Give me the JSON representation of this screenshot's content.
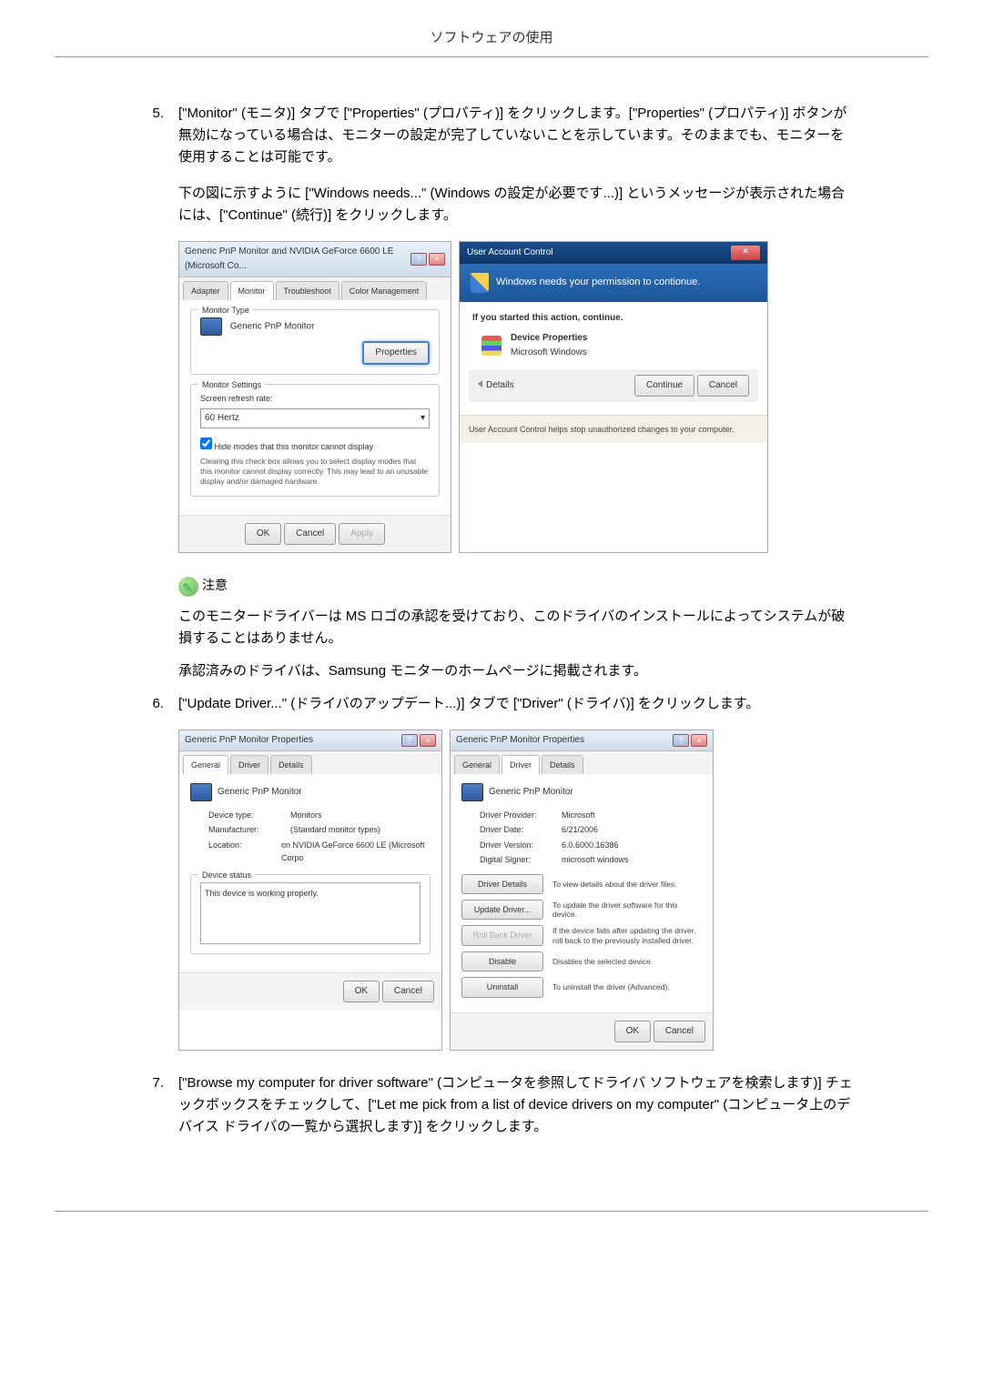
{
  "header": "ソフトウェアの使用",
  "step5": {
    "num": "5.",
    "text": "[\"Monitor\" (モニタ)] タブで [\"Properties\" (プロパティ)] をクリックします。[\"Properties\" (プロパティ)] ボタンが無効になっている場合は、モニターの設定が完了していないことを示しています。そのままでも、モニターを使用することは可能です。",
    "text2": "下の図に示すように [\"Windows needs...\" (Windows の設定が必要です...)] というメッセージが表示された場合には、[\"Continue\" (続行)] をクリックします。"
  },
  "dialog1": {
    "title": "Generic PnP Monitor and NVIDIA GeForce 6600 LE (Microsoft Co...",
    "tabs": {
      "adapter": "Adapter",
      "monitor": "Monitor",
      "troubleshoot": "Troubleshoot",
      "color": "Color Management"
    },
    "monitor_type_label": "Monitor Type",
    "monitor_name": "Generic PnP Monitor",
    "properties_btn": "Properties",
    "monitor_settings_label": "Monitor Settings",
    "refresh_label": "Screen refresh rate:",
    "refresh_value": "60 Hertz",
    "hide_modes_check": "Hide modes that this monitor cannot display",
    "hide_modes_desc": "Clearing this check box allows you to select display modes that this monitor cannot display correctly. This may lead to an unusable display and/or damaged hardware.",
    "ok": "OK",
    "cancel": "Cancel",
    "apply": "Apply"
  },
  "uac": {
    "title": "User Account Control",
    "banner": "Windows needs your permission to contionue.",
    "started": "If you started this action, continue.",
    "prog_name": "Device Properties",
    "prog_vendor": "Microsoft Windows",
    "details": "Details",
    "continue": "Continue",
    "cancel": "Cancel",
    "footer": "User Account Control helps stop unauthorized changes to your computer."
  },
  "note": {
    "label": "注意",
    "text1": "このモニタードライバーは MS ロゴの承認を受けており、このドライバのインストールによってシステムが破損することはありません。",
    "text2": "承認済みのドライバは、Samsung モニターのホームページに掲載されます。"
  },
  "step6": {
    "num": "6.",
    "text": "[\"Update Driver...\" (ドライバのアップデート...)] タブで [\"Driver\" (ドライバ)] をクリックします。"
  },
  "propGen": {
    "title": "Generic PnP Monitor Properties",
    "tabs": {
      "general": "General",
      "driver": "Driver",
      "details": "Details"
    },
    "name": "Generic PnP Monitor",
    "device_type_k": "Device type:",
    "device_type_v": "Monitors",
    "manufacturer_k": "Manufacturer:",
    "manufacturer_v": "(Standard monitor types)",
    "location_k": "Location:",
    "location_v": "on NVIDIA GeForce 6600 LE (Microsoft Corpo",
    "status_label": "Device status",
    "status_text": "This device is working properly.",
    "ok": "OK",
    "cancel": "Cancel"
  },
  "propDrv": {
    "title": "Generic PnP Monitor Properties",
    "name": "Generic PnP Monitor",
    "provider_k": "Driver Provider:",
    "provider_v": "Microsoft",
    "date_k": "Driver Date:",
    "date_v": "6/21/2006",
    "version_k": "Driver Version:",
    "version_v": "6.0.6000.16386",
    "signer_k": "Digital Signer:",
    "signer_v": "microsoft windows",
    "btn_details": "Driver Details",
    "desc_details": "To view details about the driver files.",
    "btn_update": "Update Driver...",
    "desc_update": "To update the driver software for this device.",
    "btn_rollback": "Roll Back Driver",
    "desc_rollback": "If the device fails after updating the driver, roll back to the previously installed driver.",
    "btn_disable": "Disable",
    "desc_disable": "Disables the selected device.",
    "btn_uninstall": "Uninstall",
    "desc_uninstall": "To uninstall the driver (Advanced).",
    "ok": "OK",
    "cancel": "Cancel"
  },
  "step7": {
    "num": "7.",
    "text": "[\"Browse my computer for driver software\" (コンピュータを参照してドライバ ソフトウェアを検索します)] チェックボックスをチェックして、[\"Let me pick from a list of device drivers on my computer\" (コンピュータ上のデバイス ドライバの一覧から選択します)] をクリックします。"
  }
}
